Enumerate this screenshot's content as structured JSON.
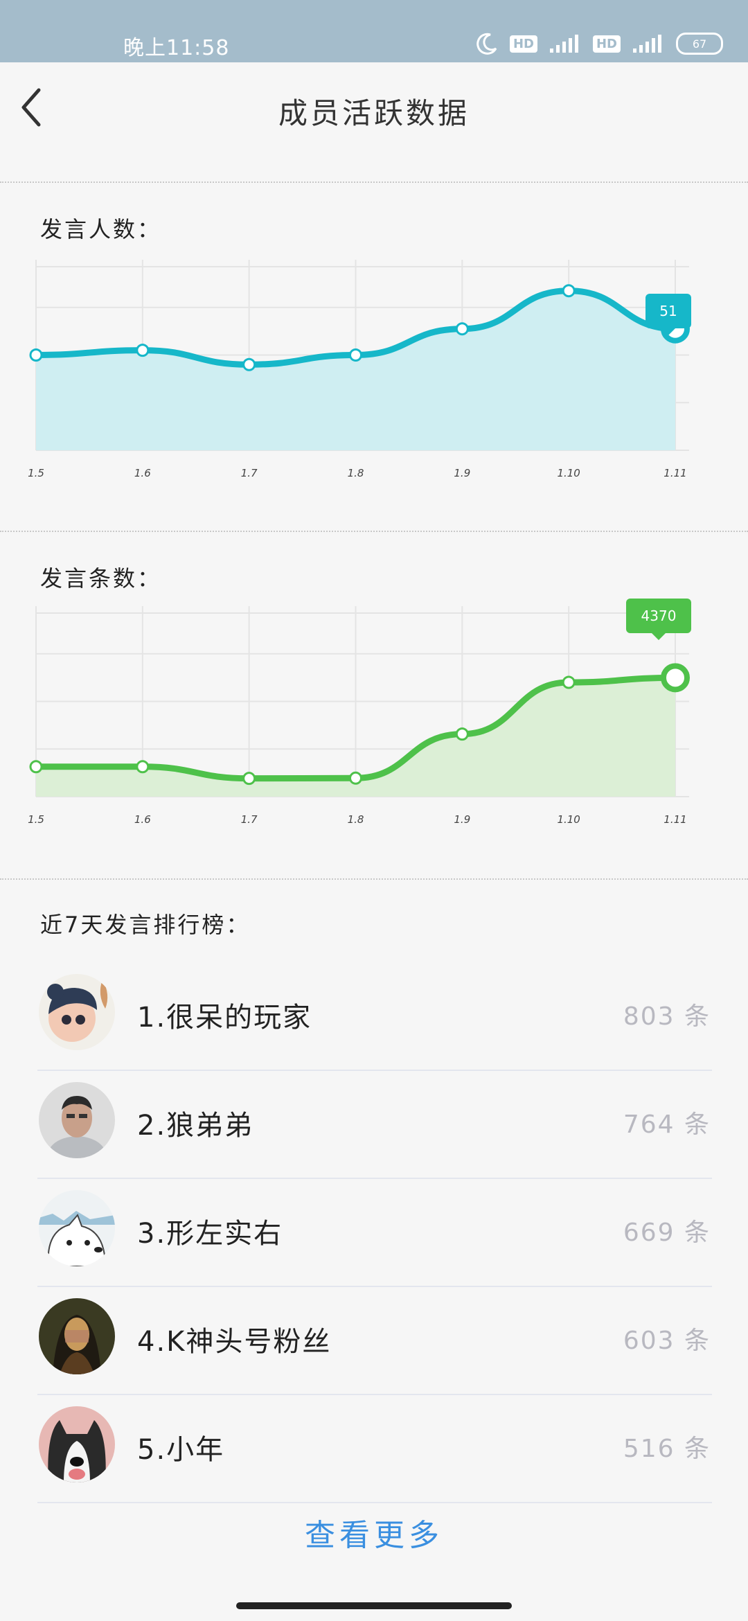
{
  "status": {
    "time": "晚上11:58",
    "hd1": "HD",
    "hd2": "HD",
    "battery": "67"
  },
  "header": {
    "title": "成员活跃数据"
  },
  "speakers": {
    "title": "发言人数：",
    "tooltip": "51",
    "chart_data": {
      "type": "area",
      "categories": [
        "1.5",
        "1.6",
        "1.7",
        "1.8",
        "1.9",
        "1.10",
        "1.11"
      ],
      "values": [
        40,
        42,
        36,
        40,
        51,
        67,
        51
      ],
      "ylim": [
        0,
        80
      ],
      "color": "#16b7c9",
      "fill": "#cfeef2"
    }
  },
  "messages": {
    "title": "发言条数：",
    "tooltip": "4370",
    "chart_data": {
      "type": "area",
      "categories": [
        "1.5",
        "1.6",
        "1.7",
        "1.8",
        "1.9",
        "1.10",
        "1.11"
      ],
      "values": [
        1100,
        1100,
        670,
        680,
        2300,
        4200,
        4370
      ],
      "ylim": [
        0,
        7000
      ],
      "color": "#4ec14a",
      "fill": "#dcefd6"
    }
  },
  "ranking": {
    "title": "近7天发言排行榜：",
    "items": [
      {
        "name": "1.很呆的玩家",
        "count": "803 条"
      },
      {
        "name": "2.狼弟弟",
        "count": "764 条"
      },
      {
        "name": "3.形左实右",
        "count": "669 条"
      },
      {
        "name": "4.K神头号粉丝",
        "count": "603 条"
      },
      {
        "name": "5.小年",
        "count": "516 条"
      }
    ]
  },
  "more_label": "查看更多"
}
